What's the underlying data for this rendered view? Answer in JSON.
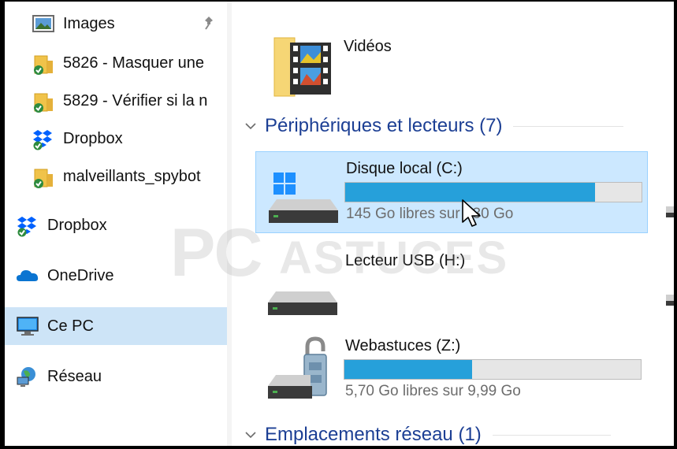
{
  "sidebar": {
    "quick_access_items": [
      {
        "label": "Images",
        "icon": "pictures-folder-icon",
        "pinned": true
      },
      {
        "label": "5826 - Masquer une",
        "icon": "folder-synced-icon"
      },
      {
        "label": "5829 - Vérifier si la n",
        "icon": "folder-synced-icon"
      },
      {
        "label": "Dropbox",
        "icon": "dropbox-icon"
      },
      {
        "label": "malveillants_spybot",
        "icon": "folder-synced-icon"
      }
    ],
    "top_items": [
      {
        "label": "Dropbox",
        "icon": "dropbox-icon"
      },
      {
        "label": "OneDrive",
        "icon": "onedrive-cloud-icon"
      },
      {
        "label": "Ce PC",
        "icon": "computer-icon",
        "selected": true
      },
      {
        "label": "Réseau",
        "icon": "network-icon"
      }
    ]
  },
  "folders": {
    "videos_label": "Vidéos"
  },
  "groups": {
    "devices_title": "Périphériques et lecteurs (7)",
    "network_title": "Emplacements réseau (1)"
  },
  "drives": [
    {
      "name": "Disque local (C:)",
      "free_text": "145 Go libres sur 930 Go",
      "used_fraction": 0.844,
      "selected": true,
      "icon": "windows-drive-icon"
    },
    {
      "name": "Lecteur USB (H:)",
      "icon": "usb-drive-icon"
    },
    {
      "name": "Webastuces (Z:)",
      "free_text": "5,70 Go libres sur 9,99 Go",
      "used_fraction": 0.43,
      "icon": "locked-drive-icon"
    }
  ],
  "watermark": {
    "brand": "PC",
    "suffix": "ASTUCES"
  },
  "colors": {
    "accent_text": "#1c3f94",
    "bar_fill": "#26a0da",
    "bar_fill_selected": "#26a0da",
    "selection_bg": "#cce8ff",
    "selection_border": "#99d1ff",
    "nav_selected": "#cde4f7"
  }
}
